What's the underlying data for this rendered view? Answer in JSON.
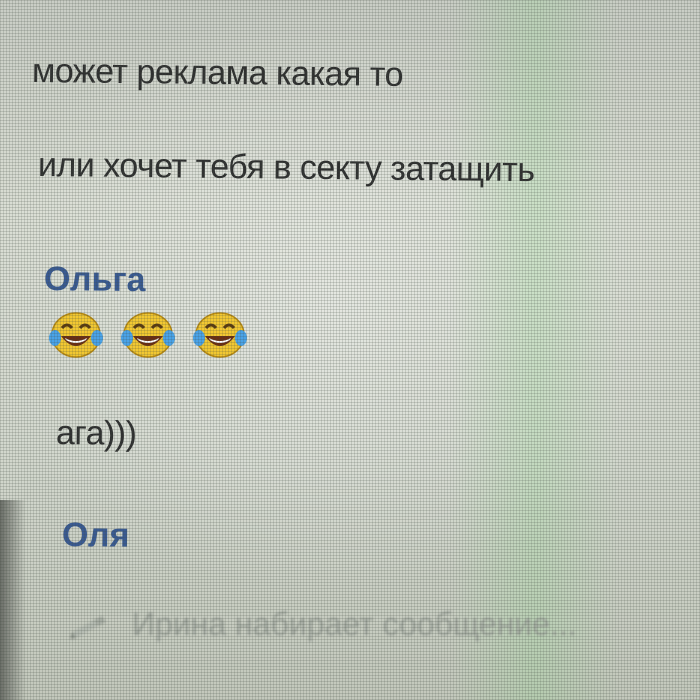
{
  "messages": {
    "first": "может реклама какая то",
    "second": "или хочет тебя в секту затащить",
    "olga_author": "Ольга",
    "olga_emoji": [
      "joy-emoji",
      "joy-emoji",
      "joy-emoji"
    ],
    "olga_text": "ага)))",
    "olya_author": "Оля"
  },
  "typing_indicator": {
    "text": "Ирина набирает сообщение..."
  },
  "colors": {
    "author": "#3a5b93",
    "message_text": "#2f3030",
    "typing_text": "#9ea49c"
  }
}
